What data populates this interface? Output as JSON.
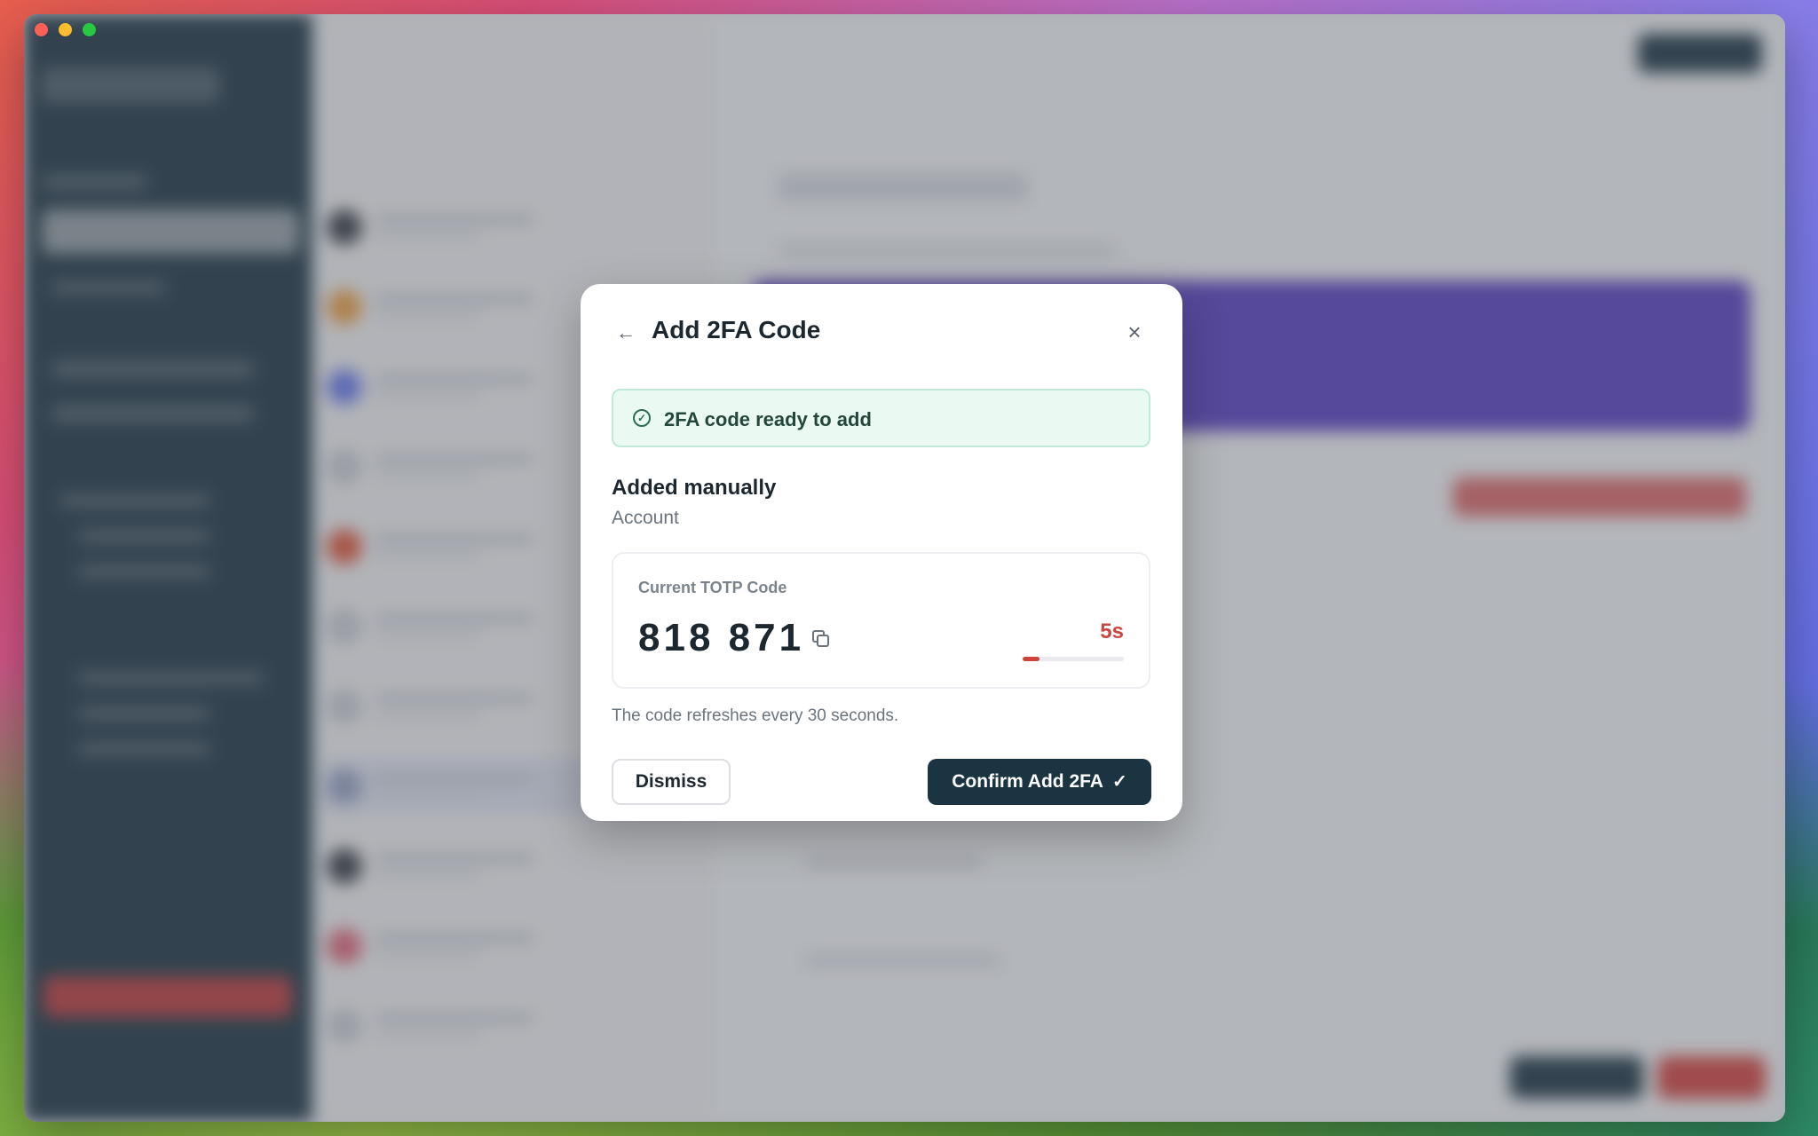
{
  "dialog": {
    "title": "Add 2FA Code",
    "back_icon": "arrow-left-icon",
    "close_icon": "close-icon",
    "status": {
      "text": "2FA code ready to add",
      "icon": "check-circle-icon",
      "color": "#2c6e55"
    },
    "account": {
      "name": "Added manually",
      "subtitle": "Account"
    },
    "totp": {
      "label": "Current TOTP Code",
      "code": "818 871",
      "copy_icon": "copy-icon",
      "remaining": "5s",
      "progress_fraction": 0.17,
      "timer_color": "#c8473f"
    },
    "note": "The code refreshes every 30 seconds.",
    "buttons": {
      "dismiss": "Dismiss",
      "confirm": "Confirm Add 2FA",
      "confirm_icon": "check-icon"
    }
  },
  "colors": {
    "primary": "#1b3442",
    "success_bg": "#eafaf3",
    "danger": "#d0433b"
  }
}
